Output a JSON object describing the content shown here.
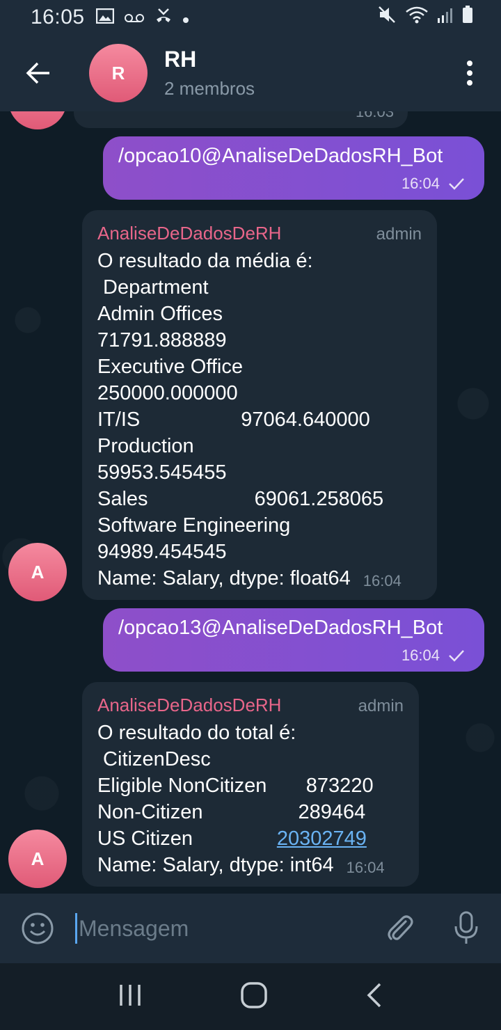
{
  "status_bar": {
    "time": "16:05",
    "icons_left": [
      "image-icon",
      "voicemail-icon",
      "missed-call-icon",
      "dot-icon"
    ],
    "icons_right": [
      "mute-icon",
      "wifi-icon",
      "signal-icon",
      "battery-icon"
    ]
  },
  "header": {
    "avatar_letter": "R",
    "title": "RH",
    "subtitle": "2 membros"
  },
  "messages": {
    "partial_timestamp": "16:03",
    "out1": {
      "text": "/opcao10@AnaliseDeDadosRH_Bot",
      "time": "16:04"
    },
    "in1": {
      "sender": "AnaliseDeDadosDeRH",
      "role": "admin",
      "avatar_letter": "A",
      "lines": [
        "O resultado da média é:",
        " Department",
        "Admin Offices",
        "71791.888889",
        "Executive Office",
        "250000.000000",
        "IT/IS                  97064.640000",
        "Production",
        "59953.545455",
        "Sales                   69061.258065",
        "Software Engineering",
        "94989.454545"
      ],
      "last_line": "Name: Salary, dtype: float64",
      "time": "16:04"
    },
    "out2": {
      "text": "/opcao13@AnaliseDeDadosRH_Bot",
      "time": "16:04"
    },
    "in2": {
      "sender": "AnaliseDeDadosDeRH",
      "role": "admin",
      "avatar_letter": "A",
      "lines": [
        "O resultado do total é:",
        " CitizenDesc",
        "Eligible NonCitizen       873220",
        "Non-Citizen                 289464"
      ],
      "us_label": "US Citizen               ",
      "us_value": "20302749",
      "last_line": "Name: Salary, dtype: int64",
      "time": "16:04"
    }
  },
  "input": {
    "placeholder": "Mensagem"
  },
  "colors": {
    "accent_out": "#8e4fc9",
    "bubble_in": "#1d2a36",
    "sender_name": "#e8668a",
    "avatar": "#e05a77",
    "link": "#6ab3f3"
  }
}
